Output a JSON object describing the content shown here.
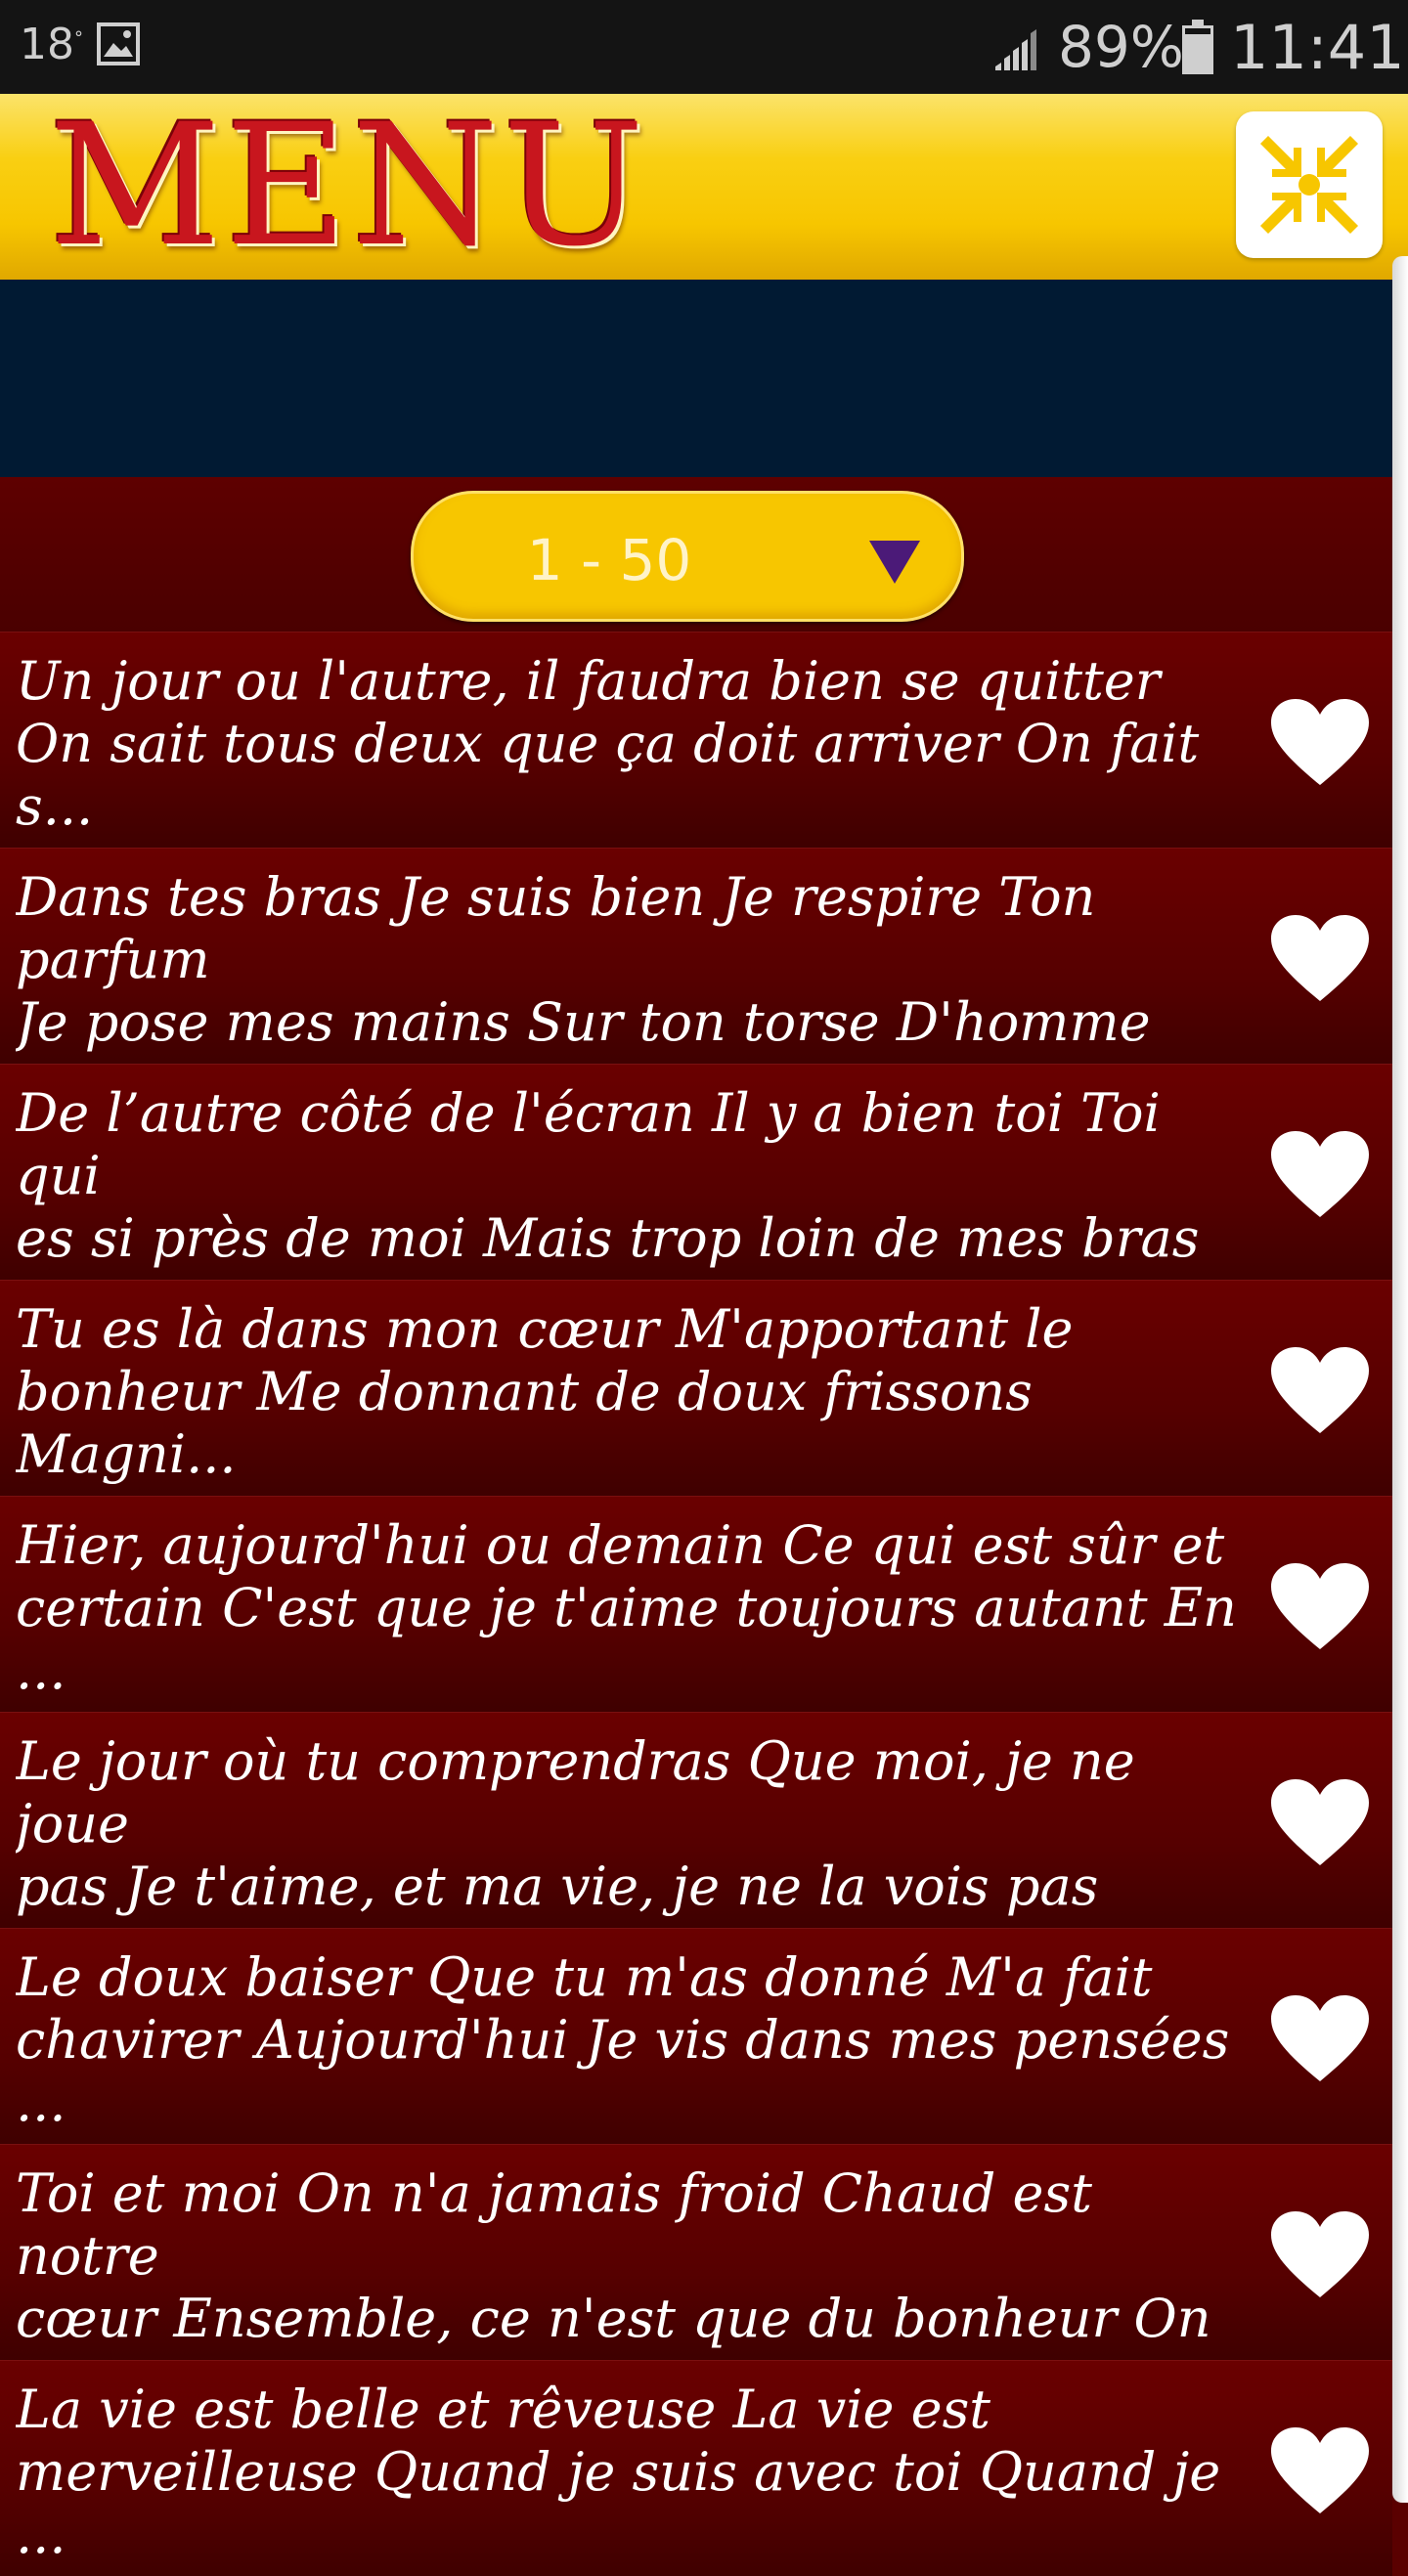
{
  "status_bar": {
    "temperature": "18",
    "battery": "89%",
    "time": "11:41"
  },
  "header": {
    "title": "MENU",
    "collapse_icon": "collapse-arrows-icon"
  },
  "range_selector": {
    "value": "1 - 50"
  },
  "colors": {
    "header_yellow": "#f7c600",
    "title_red": "#c8161e",
    "list_dark_red": "#5a0000",
    "banner_navy": "#011a33"
  },
  "list": {
    "items": [
      {
        "text": "Un jour ou l'autre, il faudra bien se quitter\nOn sait tous deux que ça doit arriver On fait s..."
      },
      {
        "text": "Dans tes bras Je suis bien Je respire Ton parfum\nJe pose mes mains Sur ton torse D'homme mu..."
      },
      {
        "text": "De l’autre côté de l'écran Il y a bien toi Toi qui\nes si près de moi Mais trop loin de mes bras E..."
      },
      {
        "text": "Tu es là dans mon cœur M'apportant le\nbonheur Me donnant de doux frissons Magni..."
      },
      {
        "text": "Hier, aujourd'hui ou demain Ce qui est sûr et\ncertain C'est que je t'aime toujours autant En ..."
      },
      {
        "text": "Le jour où tu comprendras Que moi, je ne joue\npas Je t'aime, et ma vie, je ne la vois pas Sans ..."
      },
      {
        "text": "Le doux baiser Que tu m'as donné M'a fait\nchavirer Aujourd'hui Je vis dans mes pensées ..."
      },
      {
        "text": "Toi et moi On n'a jamais froid Chaud est notre\ncœur Ensemble, ce n'est que du bonheur On p..."
      },
      {
        "text": "La vie est belle et rêveuse La vie est\nmerveilleuse Quand je suis avec toi Quand je ..."
      }
    ]
  }
}
